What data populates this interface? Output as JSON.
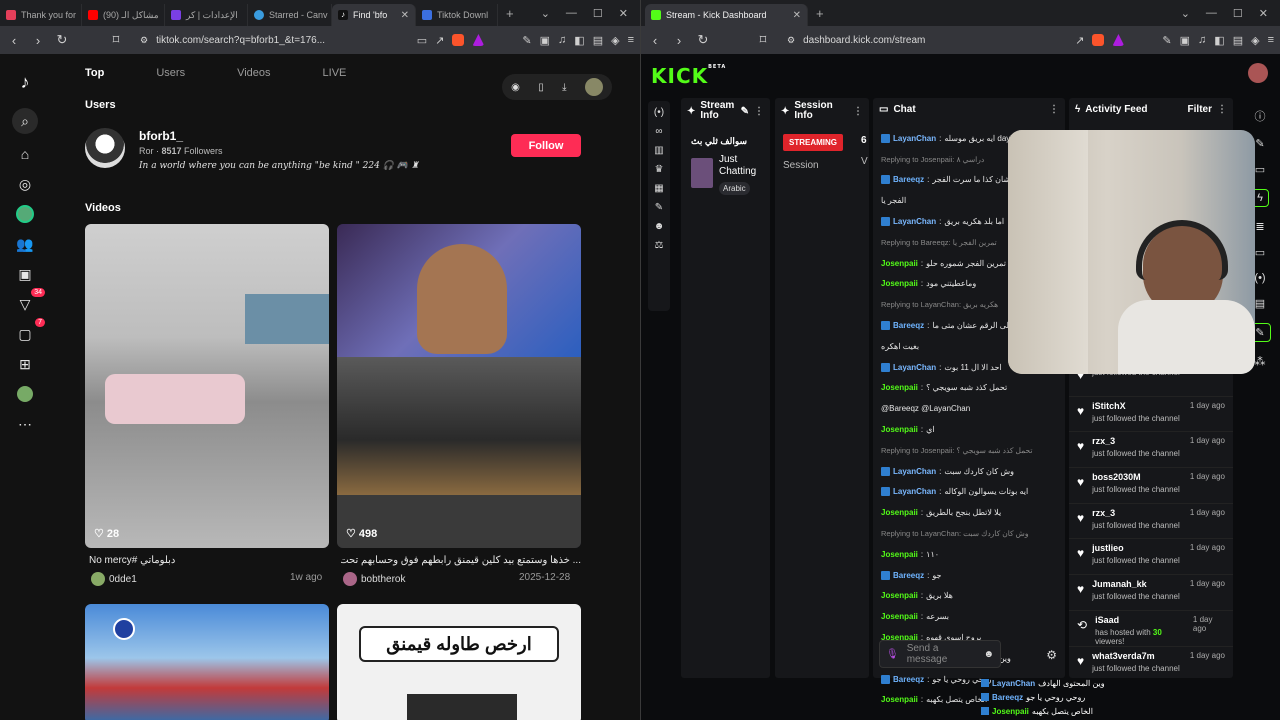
{
  "left": {
    "tabs": [
      {
        "title": "Thank you for",
        "color": "#e43f5a"
      },
      {
        "title": "(90) مشاكل الـ",
        "color": "#ff0000"
      },
      {
        "title": "الإعدادات | كر",
        "color": "#7a3fe4"
      },
      {
        "title": "Starred - Canv",
        "color": "#3a9cdf"
      },
      {
        "title": "Find 'bfo",
        "color": "#111"
      },
      {
        "title": "Tiktok Downl",
        "color": "#3b6fe0"
      }
    ],
    "url": "tiktok.com/search?q=bforb1_&t=176...",
    "search_tabs": [
      "Top",
      "Users",
      "Videos",
      "LIVE"
    ],
    "users_heading": "Users",
    "user": {
      "name": "bforb1_",
      "meta_prefix": "Ror · ",
      "followers": "8517",
      "followers_label": " Followers",
      "bio": "In a world where you can be anything \"be kind \" 224 🎧 🎮 ♜",
      "follow_label": "Follow"
    },
    "videos_heading": "Videos",
    "side_badges": {
      "activity": "34",
      "messages": "7"
    },
    "videos": [
      {
        "likes": "28",
        "caption": "دبلوماتي #No mercy",
        "author": "0dde1",
        "date": "1w ago"
      },
      {
        "likes": "498",
        "caption": "... خذها وستمتع بيد كلين قيمنق رابطهم فوق وحسابهم تحت",
        "author": "bobtherok",
        "date": "2025-12-28"
      },
      {
        "banner": "ارخص طاوله قيمنق"
      }
    ]
  },
  "right": {
    "tab": "Stream - Kick Dashboard",
    "url": "dashboard.kick.com/stream",
    "logo": "KICK",
    "logo_sup": "BETA",
    "panels": {
      "stream_info": "Stream Info",
      "session_info": "Session Info",
      "chat": "Chat",
      "activity": "Activity Feed",
      "filter": "Filter"
    },
    "stream": {
      "title": "سوالف ثلي بث",
      "category": "Just Chatting",
      "language": "Arabic"
    },
    "session": {
      "status": "STREAMING",
      "count": "6",
      "label": "Session",
      "extra": "V"
    },
    "chat": [
      {
        "name": "LayanChan",
        "text": "ايه بريق موسله day7",
        "color": "#7ab8ff",
        "badge": true
      },
      {
        "reply": "Replying to Josenpaii: دراسي ٨"
      },
      {
        "name": "Bareeqz",
        "text": "بس عشان كذا ما سرت الفجر",
        "color": "#6fb4ff",
        "badge": true
      },
      {
        "text": "الفجر يا"
      },
      {
        "name": "LayanChan",
        "text": "اما بلد هكريه بريق",
        "color": "#7ab8ff",
        "badge": true
      },
      {
        "reply": "Replying to Bareeqz: تمرين الفجر يا"
      },
      {
        "name": "Josenpaii",
        "text": "الله تمرين الفجر شموره حلو",
        "color": "#53fc18"
      },
      {
        "name": "Josenpaii",
        "text": "وماعطيتني مود",
        "color": "#53fc18"
      },
      {
        "reply": "Replying to LayanChan: هكريه بريق"
      },
      {
        "name": "Bareeqz",
        "text": "على الرقم عشان متى ما",
        "color": "#6fb4ff",
        "badge": true
      },
      {
        "text": "بغيت اهكره"
      },
      {
        "name": "LayanChan",
        "text": "احد الا ال 11 بوت",
        "color": "#7ab8ff",
        "badge": true
      },
      {
        "name": "Josenpaii",
        "text": "تحمل كذد شبه سويجي ؟",
        "color": "#53fc18"
      },
      {
        "text": "@Bareeqz @LayanChan"
      },
      {
        "name": "Josenpaii",
        "text": "اي",
        "color": "#53fc18"
      },
      {
        "reply": "Replying to Josenpaii: تحمل كذد شبه سويجي ؟"
      },
      {
        "name": "LayanChan",
        "text": "وش كان كاردك سبت",
        "color": "#7ab8ff",
        "badge": true
      },
      {
        "name": "LayanChan",
        "text": "ايه بوتات يسوالون الوكاله",
        "color": "#7ab8ff",
        "badge": true
      },
      {
        "name": "Josenpaii",
        "text": "يلا لاتطل بنجح بالطريق",
        "color": "#53fc18"
      },
      {
        "reply": "Replying to LayanChan: وش كان كاردك سبت"
      },
      {
        "name": "Josenpaii",
        "text": "١١٠",
        "color": "#53fc18"
      },
      {
        "name": "Bareeqz",
        "text": "جو",
        "color": "#6fb4ff",
        "badge": true
      },
      {
        "name": "Josenpaii",
        "text": "هلا بريق",
        "color": "#53fc18"
      },
      {
        "name": "Josenpaii",
        "text": "بسرعه",
        "color": "#53fc18"
      },
      {
        "name": "Josenpaii",
        "text": "بروح اسوي قهوه",
        "color": "#53fc18"
      },
      {
        "name": "LayanChan",
        "text": "وين المحتوى الهادف",
        "color": "#7ab8ff",
        "badge": true
      },
      {
        "name": "Bareeqz",
        "text": "روحي روحي يا جو",
        "color": "#6fb4ff",
        "badge": true
      },
      {
        "name": "Josenpaii",
        "text": "الخاص يتصل بكهبه",
        "color": "#53fc18"
      }
    ],
    "chat_placeholder": "Send a message",
    "activity": [
      {
        "name": "",
        "desc": "just followed the channel",
        "age": ""
      },
      {
        "name": "iStitchX",
        "desc": "just followed the channel",
        "age": "1 day ago"
      },
      {
        "name": "rzx_3",
        "desc": "just followed the channel",
        "age": "1 day ago"
      },
      {
        "name": "boss2030M",
        "desc": "just followed the channel",
        "age": "1 day ago"
      },
      {
        "name": "rzx_3",
        "desc": "just followed the channel",
        "age": "1 day ago"
      },
      {
        "name": "justlieo",
        "desc": "just followed the channel",
        "age": "1 day ago"
      },
      {
        "name": "Jumanah_kk",
        "desc": "just followed the channel",
        "age": "1 day ago"
      },
      {
        "name": "iSaad",
        "desc_prefix": "has hosted with ",
        "viewers": "30",
        "desc_suffix": " viewers!",
        "age": "1 day ago"
      },
      {
        "name": "what3verda7m",
        "desc": "just followed the channel",
        "age": "1 day ago"
      }
    ],
    "overlay_chat": [
      {
        "name": "LayanChan",
        "text": "وين المحتوى الهادف",
        "color": "#7ab8ff"
      },
      {
        "name": "Bareeqz",
        "text": "روحي روحي يا جو",
        "color": "#6fb4ff"
      },
      {
        "name": "Josenpaii",
        "text": "الخاص يتصل بكهبه",
        "color": "#53fc18"
      }
    ]
  }
}
